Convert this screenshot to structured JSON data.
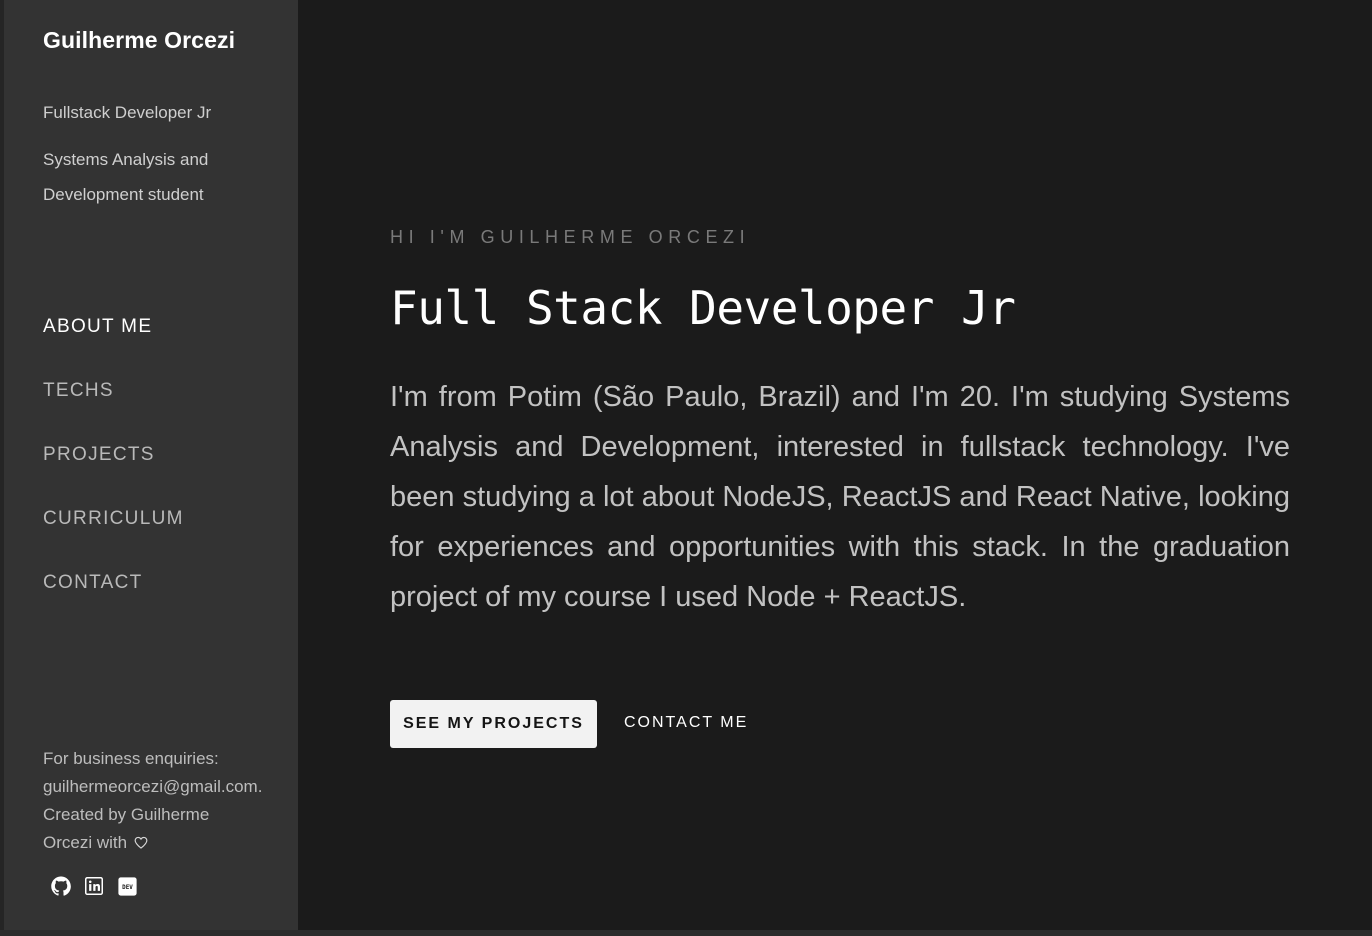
{
  "sidebar": {
    "brand": "Guilherme Orcezi",
    "tagline_role": "Fullstack Developer Jr",
    "tagline_study": "Systems Analysis and Development student",
    "nav": [
      {
        "label": "ABOUT ME",
        "active": true
      },
      {
        "label": "TECHS",
        "active": false
      },
      {
        "label": "PROJECTS",
        "active": false
      },
      {
        "label": "CURRICULUM",
        "active": false
      },
      {
        "label": "CONTACT",
        "active": false
      }
    ],
    "footer": {
      "line1": "For business enquiries:",
      "line2": "guilhermeorcezi@gmail.com.",
      "line3": "Created by Guilherme",
      "line4": "Orcezi with"
    },
    "socials": [
      "github-icon",
      "linkedin-icon",
      "dev-icon"
    ]
  },
  "main": {
    "eyebrow": "HI I'M GUILHERME ORCEZI",
    "headline": "Full Stack Developer Jr",
    "bio": "I'm from Potim (São Paulo, Brazil) and I'm 20. I'm studying Systems Analysis and Development, interested in fullstack technology. I've been studying a lot about NodeJS, ReactJS and React Native, looking for experiences and opportunities with this stack. In the graduation project of my course I used Node + ReactJS.",
    "primary_button": "SEE MY PROJECTS",
    "secondary_button": "CONTACT ME"
  },
  "colors": {
    "background": "#1b1b1b",
    "sidebar": "#333333",
    "accent_text": "#ffffff"
  }
}
